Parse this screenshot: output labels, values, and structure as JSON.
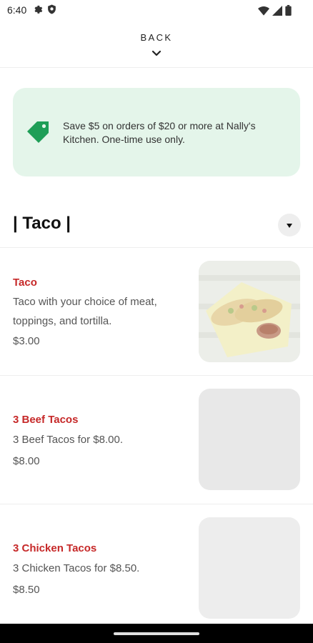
{
  "status_bar": {
    "time": "6:40",
    "left_icons": [
      "gear-icon",
      "shield-icon"
    ],
    "right_icons": [
      "wifi-icon",
      "signal-icon",
      "battery-icon"
    ]
  },
  "header": {
    "back_label": "BACK",
    "back_icon": "chevron-down-icon"
  },
  "promo": {
    "icon": "tag-icon",
    "text": "Save $5 on orders of $20 or more at Nally's Kitchen. One-time use only.",
    "colors": {
      "background": "#e4f5ea",
      "icon": "#1e9e57"
    }
  },
  "section": {
    "title": "| Taco |",
    "toggle_icon": "caret-down-icon"
  },
  "items": [
    {
      "name": "Taco",
      "description": "Taco with your choice of meat, toppings, and tortilla.",
      "price": "$3.00",
      "has_photo": true
    },
    {
      "name": "3 Beef Tacos",
      "description": "3 Beef Tacos for $8.00.",
      "price": "$8.00",
      "has_photo": false
    },
    {
      "name": "3 Chicken Tacos",
      "description": "3 Chicken Tacos for $8.50.",
      "price": "$8.50",
      "has_photo": false
    }
  ],
  "colors": {
    "item_name": "#c62828",
    "text_secondary": "#555555"
  }
}
